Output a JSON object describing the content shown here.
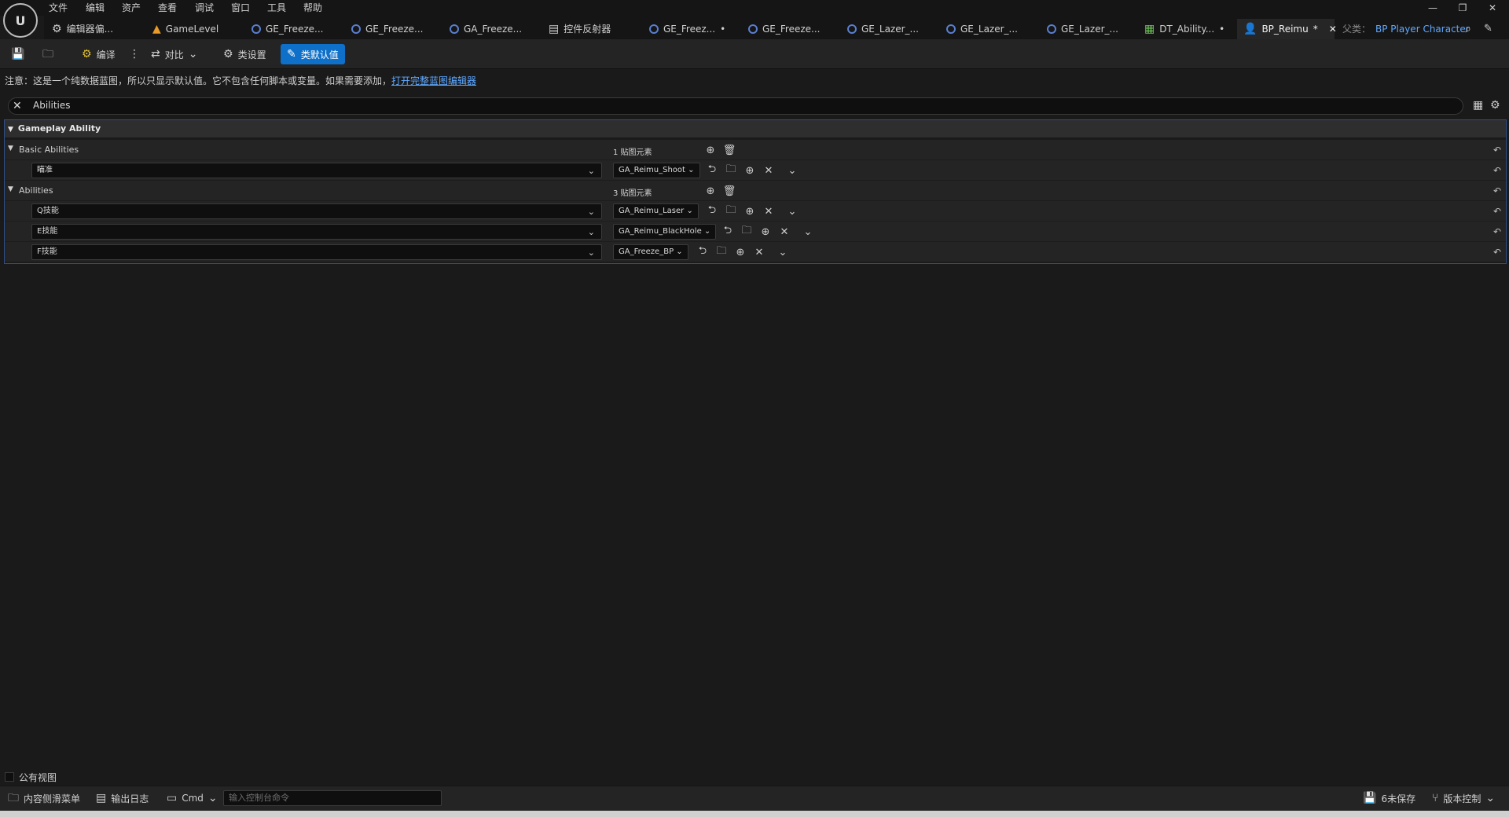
{
  "menu": [
    "文件",
    "编辑",
    "资产",
    "查看",
    "调试",
    "窗口",
    "工具",
    "帮助"
  ],
  "tabs": [
    {
      "label": "编辑器偏...",
      "icon": "settings-sliders-icon"
    },
    {
      "label": "GameLevel",
      "icon": "level-icon"
    },
    {
      "label": "GE_Freeze...",
      "icon": "blueprint-icon"
    },
    {
      "label": "GE_Freeze...",
      "icon": "blueprint-icon"
    },
    {
      "label": "GA_Freeze...",
      "icon": "blueprint-icon"
    },
    {
      "label": "控件反射器",
      "icon": "widget-reflector-icon"
    },
    {
      "label": "GE_Freez...",
      "icon": "blueprint-icon"
    },
    {
      "label": "GE_Freeze...",
      "icon": "blueprint-icon"
    },
    {
      "label": "GE_Lazer_...",
      "icon": "blueprint-icon"
    },
    {
      "label": "GE_Lazer_...",
      "icon": "blueprint-icon"
    },
    {
      "label": "GE_Lazer_...",
      "icon": "blueprint-icon"
    },
    {
      "label": "DT_Ability...",
      "icon": "datatable-icon"
    },
    {
      "label": "BP_Reimu",
      "icon": "character-icon"
    }
  ],
  "parent_label": "父类：",
  "parent_value": "BP Player Character",
  "toolbar": {
    "compile": "编译",
    "diff": "对比",
    "class_settings": "类设置",
    "class_defaults": "类默认值"
  },
  "notice_text": "注意：这是一个纯数据蓝图，所以只显示默认值。它不包含任何脚本或变量。如果需要添加，",
  "notice_link": "打开完整蓝图编辑器",
  "search_value": "Abilities",
  "category": "Gameplay Ability",
  "basic_abilities": {
    "label": "Basic Abilities",
    "count": "1 贴图元素",
    "items": [
      {
        "key": "瞄准",
        "value": "GA_Reimu_Shoot"
      }
    ]
  },
  "abilities": {
    "label": "Abilities",
    "count": "3 贴图元素",
    "items": [
      {
        "key": "Q技能",
        "value": "GA_Reimu_Laser"
      },
      {
        "key": "E技能",
        "value": "GA_Reimu_BlackHole"
      },
      {
        "key": "F技能",
        "value": "GA_Freeze_BP"
      }
    ]
  },
  "public_view": "公有视图",
  "bottom": {
    "content_drawer": "内容侧滑菜单",
    "output_log": "输出日志",
    "cmd": "Cmd",
    "cmd_placeholder": "输入控制台命令",
    "unsaved": "6未保存",
    "source_control": "版本控制"
  },
  "colors": {
    "accent": "#0e70c8",
    "link": "#5fa8ff",
    "panel_border": "#2f4e88"
  }
}
